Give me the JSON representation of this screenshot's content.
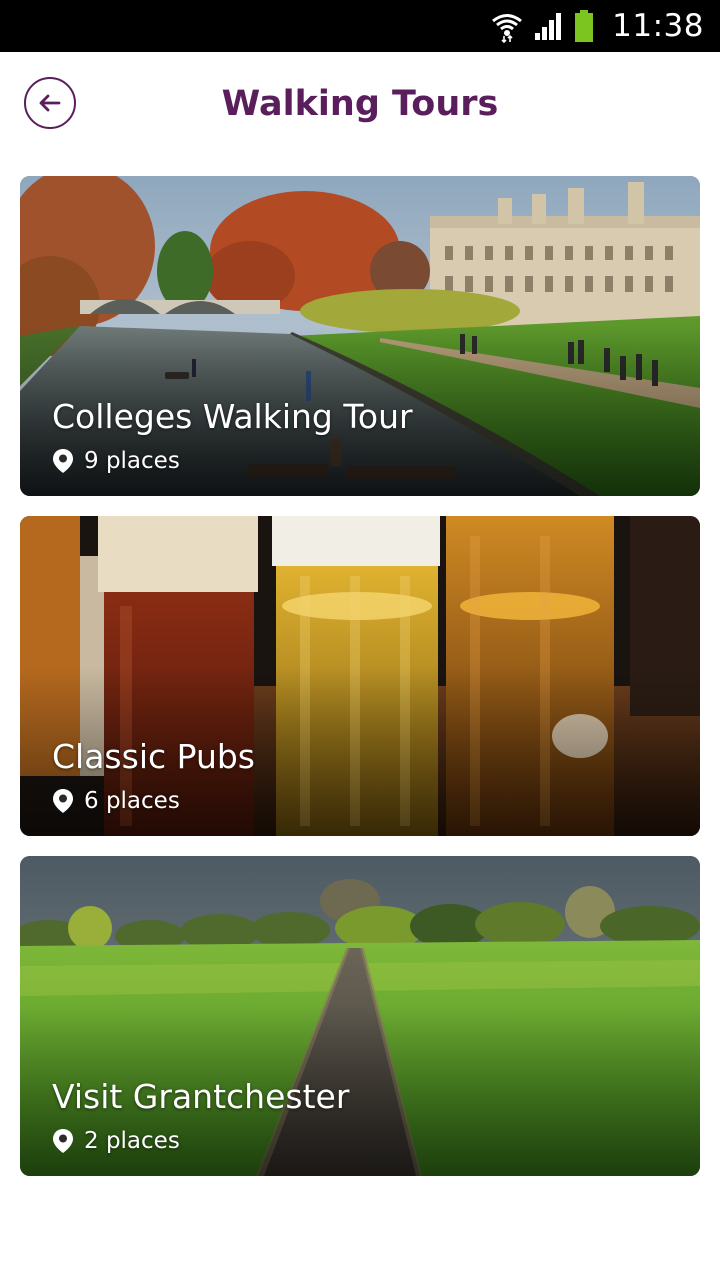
{
  "status_bar": {
    "time": "11:38",
    "icons": [
      "wifi-icon",
      "signal-icon",
      "battery-icon"
    ],
    "battery_color": "#7cc520"
  },
  "header": {
    "title": "Walking Tours",
    "back_icon": "arrow-left-icon",
    "accent_color": "#5a1e5c"
  },
  "tours": [
    {
      "title": "Colleges Walking Tour",
      "places": "9 places",
      "icon": "location-pin-icon"
    },
    {
      "title": "Classic Pubs",
      "places": "6 places",
      "icon": "location-pin-icon"
    },
    {
      "title": "Visit Grantchester",
      "places": "2 places",
      "icon": "location-pin-icon"
    }
  ]
}
